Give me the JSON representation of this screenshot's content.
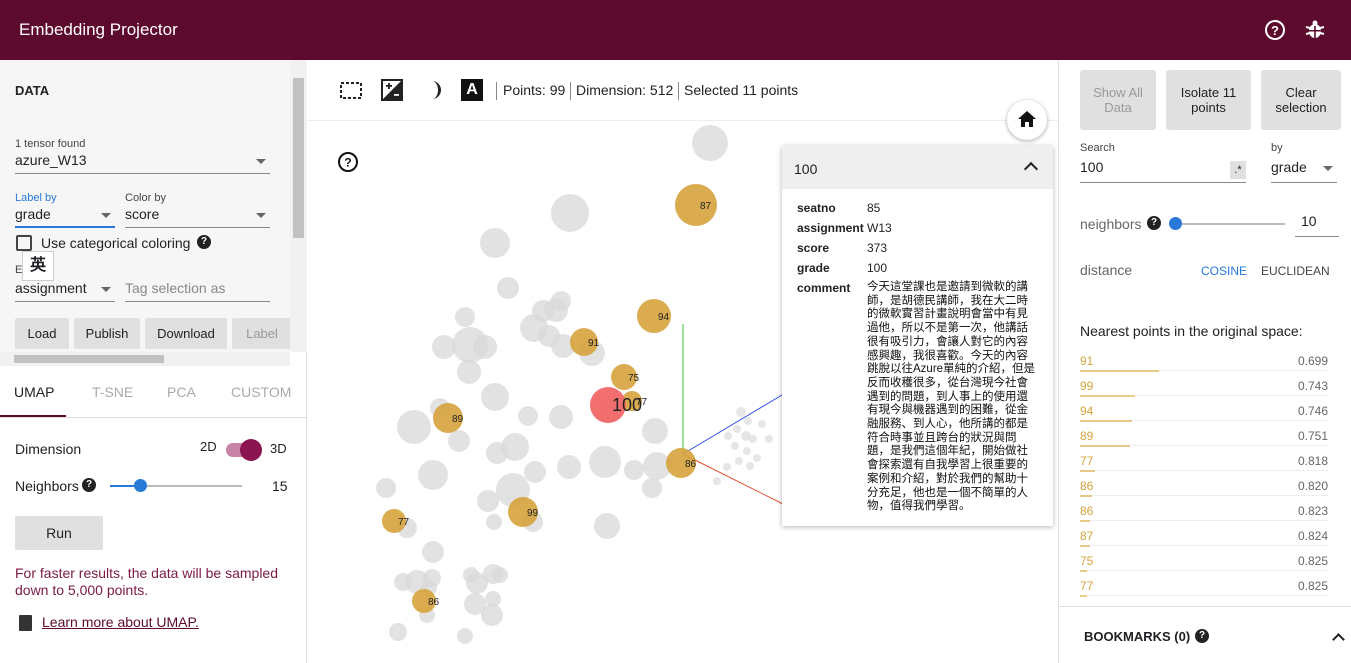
{
  "app": {
    "title": "Embedding Projector"
  },
  "left": {
    "section_title": "DATA",
    "tensor_found": "1 tensor found",
    "tensor_name": "azure_W13",
    "label_by_label": "Label by",
    "label_by_value": "grade",
    "color_by_label": "Color by",
    "color_by_value": "score",
    "categorical_label": "Use categorical coloring",
    "ime_char": "英",
    "edit_by_partial": "E",
    "edit_by_value": "assignment",
    "tag_placeholder": "Tag selection as",
    "buttons": {
      "load": "Load",
      "publish": "Publish",
      "download": "Download",
      "label": "Label"
    },
    "tabs": {
      "umap": "UMAP",
      "tsne": "T-SNE",
      "pca": "PCA",
      "custom": "CUSTOM"
    },
    "dimension_label": "Dimension",
    "dim_2d": "2D",
    "dim_3d": "3D",
    "neighbors_label": "Neighbors",
    "neighbors_value": "15",
    "neighbors_level": 0.23,
    "run_label": "Run",
    "sample_note": "For faster results, the data will be sampled down to 5,000 points.",
    "learn_more": "Learn more about UMAP."
  },
  "toolbar": {
    "points": "Points: 99",
    "dimension": "Dimension: 512",
    "selected": "Selected 11 points"
  },
  "popup": {
    "title": "100",
    "fields": [
      {
        "key": "seatno",
        "value": "85"
      },
      {
        "key": "assignment",
        "value": "W13"
      },
      {
        "key": "score",
        "value": "373"
      },
      {
        "key": "grade",
        "value": "100"
      },
      {
        "key": "comment",
        "value": ""
      }
    ],
    "comment": "今天這堂課也是邀請到微軟的講師，是胡德民講師，我在大二時的微軟實習計畫說明會當中有見過他，所以不是第一次，他講話很有吸引力，會讓人對它的內容感興趣，我很喜歡。今天的內容跳脫以往Azure單純的介紹，但是反而收穫很多，從台灣現今社會遇到的問題，到人事上的使用還有現今與機器遇到的困難，從金融服務、到人心，他所講的都是符合時事並且跨台的狀況與問題，是我們這個年紀，開始做社會探索還有自我學習上很重要的案例和介紹，對於我們的幫助十分充足，他也是一個不簡單的人物，值得我們學習。"
  },
  "scatter": {
    "selected_label": "100",
    "labels": [
      "87",
      "94",
      "91",
      "75",
      "77",
      "89",
      "86",
      "99",
      "77",
      "86"
    ]
  },
  "right": {
    "show_all": "Show All Data",
    "isolate": "Isolate 11 points",
    "clear": "Clear selection",
    "search_label": "Search",
    "search_value": "100",
    "regex": ".*",
    "by_label": "by",
    "by_value": "grade",
    "neighbors_label": "neighbors",
    "neighbors_value": "10",
    "neighbors_level": 0.0,
    "distance_label": "distance",
    "cosine": "COSINE",
    "euclidean": "EUCLIDEAN",
    "nearest_title": "Nearest points in the original space:",
    "nearest": [
      {
        "label": "91",
        "value": "0.699"
      },
      {
        "label": "99",
        "value": "0.743"
      },
      {
        "label": "94",
        "value": "0.746"
      },
      {
        "label": "89",
        "value": "0.751"
      },
      {
        "label": "77",
        "value": "0.818"
      },
      {
        "label": "86",
        "value": "0.820"
      },
      {
        "label": "86",
        "value": "0.823"
      },
      {
        "label": "87",
        "value": "0.824"
      },
      {
        "label": "75",
        "value": "0.825"
      },
      {
        "label": "77",
        "value": "0.825"
      }
    ],
    "bookmarks": "BOOKMARKS (0)"
  },
  "colors": {
    "brand": "#5c0a2d",
    "highlight": "#d6a33c",
    "selected": "#f06767",
    "accent": "#2979d8"
  }
}
